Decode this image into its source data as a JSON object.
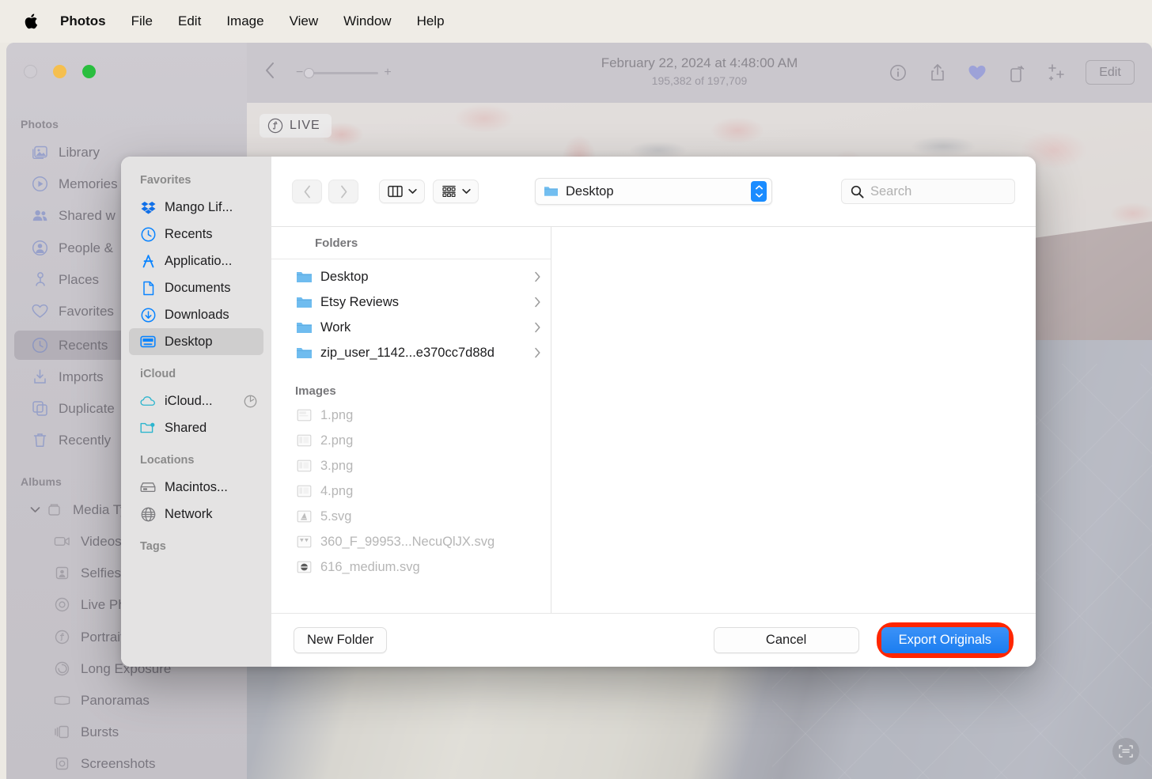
{
  "menubar": {
    "apple_icon": "apple-logo-icon",
    "items": [
      {
        "label": "Photos",
        "bold": true
      },
      {
        "label": "File",
        "bold": false
      },
      {
        "label": "Edit",
        "bold": false
      },
      {
        "label": "Image",
        "bold": false
      },
      {
        "label": "View",
        "bold": false
      },
      {
        "label": "Window",
        "bold": false
      },
      {
        "label": "Help",
        "bold": false
      }
    ]
  },
  "photos_window": {
    "traffic_lights": [
      "close-grey",
      "minimize-yellow",
      "zoom-green"
    ],
    "toolbar": {
      "back_icon": "chevron-left-icon",
      "zoom_minus": "−",
      "zoom_plus": "+",
      "title": "February 22, 2024 at 4:48:00 AM",
      "subtitle": "195,382 of 197,709",
      "icons": [
        "info-icon",
        "share-icon",
        "heart-icon",
        "rotate-icon",
        "enhance-icon"
      ],
      "edit_label": "Edit"
    },
    "live_badge": "LIVE",
    "livetext_icon": "live-text-scan-icon",
    "sidebar": {
      "sections": [
        {
          "header": "Photos",
          "items": [
            {
              "label": "Library",
              "icon": "photos-library-icon",
              "selected": false
            },
            {
              "label": "Memories",
              "icon": "memories-play-icon",
              "selected": false
            },
            {
              "label": "Shared w",
              "icon": "shared-people-icon",
              "selected": false
            },
            {
              "label": "People &",
              "icon": "people-person-icon",
              "selected": false
            },
            {
              "label": "Places",
              "icon": "places-pin-icon",
              "selected": false
            },
            {
              "label": "Favorites",
              "icon": "heart-icon",
              "selected": false
            },
            {
              "label": "Recents",
              "icon": "clock-icon",
              "selected": true
            },
            {
              "label": "Imports",
              "icon": "import-arrow-icon",
              "selected": false
            },
            {
              "label": "Duplicate",
              "icon": "duplicates-icon",
              "selected": false
            },
            {
              "label": "Recently",
              "icon": "trash-icon",
              "selected": false
            }
          ]
        },
        {
          "header": "Albums",
          "items": [
            {
              "label": "Media Ty",
              "icon": "album-box-icon",
              "selected": false,
              "disclosure": true
            },
            {
              "label": "Videos",
              "icon": "video-camera-icon",
              "selected": false,
              "indent": true
            },
            {
              "label": "Selfies",
              "icon": "selfie-icon",
              "selected": false,
              "indent": true
            },
            {
              "label": "Live Ph",
              "icon": "live-photo-icon",
              "selected": false,
              "indent": true
            },
            {
              "label": "Portrait",
              "icon": "portrait-f-icon",
              "selected": false,
              "indent": true
            },
            {
              "label": "Long Exposure",
              "icon": "long-exposure-icon",
              "selected": false,
              "indent": true
            },
            {
              "label": "Panoramas",
              "icon": "panorama-icon",
              "selected": false,
              "indent": true
            },
            {
              "label": "Bursts",
              "icon": "bursts-icon",
              "selected": false,
              "indent": true
            },
            {
              "label": "Screenshots",
              "icon": "screenshot-camera-icon",
              "selected": false,
              "indent": true
            }
          ]
        }
      ]
    }
  },
  "dialog": {
    "sidebar": {
      "sections": [
        {
          "header": "Favorites",
          "items": [
            {
              "label": "Mango Lif...",
              "icon": "dropbox-icon",
              "selected": false
            },
            {
              "label": "Recents",
              "icon": "clock-icon",
              "selected": false
            },
            {
              "label": "Applicatio...",
              "icon": "applications-a-icon",
              "selected": false
            },
            {
              "label": "Documents",
              "icon": "document-page-icon",
              "selected": false
            },
            {
              "label": "Downloads",
              "icon": "download-arrow-icon",
              "selected": false
            },
            {
              "label": "Desktop",
              "icon": "desktop-monitor-icon",
              "selected": true
            }
          ]
        },
        {
          "header": "iCloud",
          "items": [
            {
              "label": "iCloud...",
              "icon": "icloud-cloud-icon",
              "selected": false,
              "extra_icon": "sync-progress-icon"
            },
            {
              "label": "Shared",
              "icon": "shared-folder-icon",
              "selected": false
            }
          ]
        },
        {
          "header": "Locations",
          "items": [
            {
              "label": "Macintos...",
              "icon": "hard-drive-icon",
              "selected": false
            },
            {
              "label": "Network",
              "icon": "globe-network-icon",
              "selected": false
            }
          ]
        },
        {
          "header": "Tags",
          "items": []
        }
      ]
    },
    "toolbar": {
      "back_icon": "chevron-left-icon",
      "forward_icon": "chevron-right-icon",
      "view_mode_icon": "column-view-icon",
      "view_mode_chevron": "chevron-down-icon",
      "group_by_icon": "group-by-grid-icon",
      "group_by_chevron": "chevron-down-icon",
      "path_folder_icon": "folder-icon",
      "path_name": "Desktop",
      "path_stepper_icon": "stepper-up-down-icon",
      "search_icon": "search-icon",
      "search_value": "",
      "search_placeholder": "Search"
    },
    "browser": {
      "column_header": "Folders",
      "folders": [
        {
          "name": "Desktop",
          "icon": "folder-icon",
          "chevron": "chevron-right-icon"
        },
        {
          "name": "Etsy Reviews",
          "icon": "folder-icon",
          "chevron": "chevron-right-icon"
        },
        {
          "name": "Work",
          "icon": "folder-icon",
          "chevron": "chevron-right-icon"
        },
        {
          "name": "zip_user_1142...e370cc7d88d",
          "icon": "folder-icon",
          "chevron": "chevron-right-icon"
        }
      ],
      "images_header": "Images",
      "images": [
        {
          "name": "1.png",
          "icon": "png-file-icon"
        },
        {
          "name": "2.png",
          "icon": "png-file-icon"
        },
        {
          "name": "3.png",
          "icon": "png-file-icon"
        },
        {
          "name": "4.png",
          "icon": "png-file-icon"
        },
        {
          "name": "5.svg",
          "icon": "svg-file-icon"
        },
        {
          "name": "360_F_99953...NecuQlJX.svg",
          "icon": "svg-file-icon"
        },
        {
          "name": "616_medium.svg",
          "icon": "svg-file-icon"
        }
      ]
    },
    "footer": {
      "new_folder_label": "New Folder",
      "cancel_label": "Cancel",
      "export_label": "Export Originals",
      "export_highlight_color": "#FF2600",
      "export_button_color": "#2C89F5"
    }
  }
}
